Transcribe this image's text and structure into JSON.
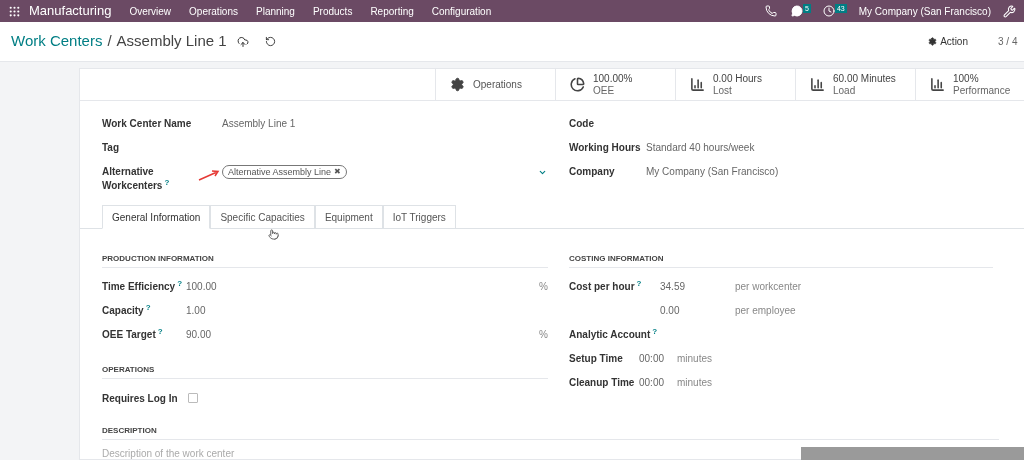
{
  "navbar": {
    "app": "Manufacturing",
    "menu": [
      "Overview",
      "Operations",
      "Planning",
      "Products",
      "Reporting",
      "Configuration"
    ],
    "chat_count": "5",
    "activity_count": "43",
    "company": "My Company (San Francisco)"
  },
  "breadcrumb": {
    "parent": "Work Centers",
    "separator": "/",
    "current": "Assembly Line 1"
  },
  "action": "Action",
  "pager": "3 / 4",
  "stat_buttons": [
    {
      "kind": "gear",
      "value": "Operations"
    },
    {
      "kind": "pie",
      "value": "100.00%",
      "label": "OEE"
    },
    {
      "kind": "bars",
      "value": "0.00 Hours",
      "label": "Lost"
    },
    {
      "kind": "bars",
      "value": "60.00 Minutes",
      "label": "Load"
    },
    {
      "kind": "bars",
      "value": "100%",
      "label": "Performance"
    }
  ],
  "main_left": [
    {
      "label": "Work Center Name",
      "value": "Assembly Line 1"
    },
    {
      "label": "Tag"
    },
    {
      "label": "Alternative Workcenters",
      "help": "?",
      "tag": "Alternative Assembly Line",
      "tag_remove": "✖"
    }
  ],
  "main_right": [
    {
      "label": "Code"
    },
    {
      "label": "Working Hours",
      "value": "Standard 40 hours/week"
    },
    {
      "label": "Company",
      "value": "My Company (San Francisco)"
    }
  ],
  "tabs": [
    {
      "label": "General Information",
      "selected": true
    },
    {
      "label": "Specific Capacities",
      "selected": false
    },
    {
      "label": "Equipment",
      "selected": false
    },
    {
      "label": "IoT Triggers",
      "selected": false
    }
  ],
  "production": {
    "heading": "PRODUCTION INFORMATION",
    "rows": [
      {
        "label": "Time Efficiency",
        "help": "?",
        "value": "100.00",
        "unit": "%"
      },
      {
        "label": "Capacity",
        "help": "?",
        "value": "1.00"
      },
      {
        "label": "OEE Target",
        "help": "?",
        "value": "90.00",
        "unit": "%"
      }
    ]
  },
  "operations": {
    "heading": "OPERATIONS",
    "requires_log_in": {
      "label": "Requires Log In",
      "checked": false
    }
  },
  "costing": {
    "heading": "COSTING INFORMATION",
    "cost_rows": [
      {
        "label": "Cost per hour",
        "help": "?",
        "value": "34.59",
        "unit": "per workcenter"
      },
      {
        "value": "0.00",
        "unit": "per employee"
      }
    ],
    "analytic": {
      "label": "Analytic Account",
      "help": "?"
    },
    "time_rows": [
      {
        "label": "Setup Time",
        "value": "00:00",
        "unit": "minutes"
      },
      {
        "label": "Cleanup Time",
        "value": "00:00",
        "unit": "minutes"
      }
    ]
  },
  "description": {
    "heading": "DESCRIPTION",
    "placeholder": "Description of the work center"
  }
}
